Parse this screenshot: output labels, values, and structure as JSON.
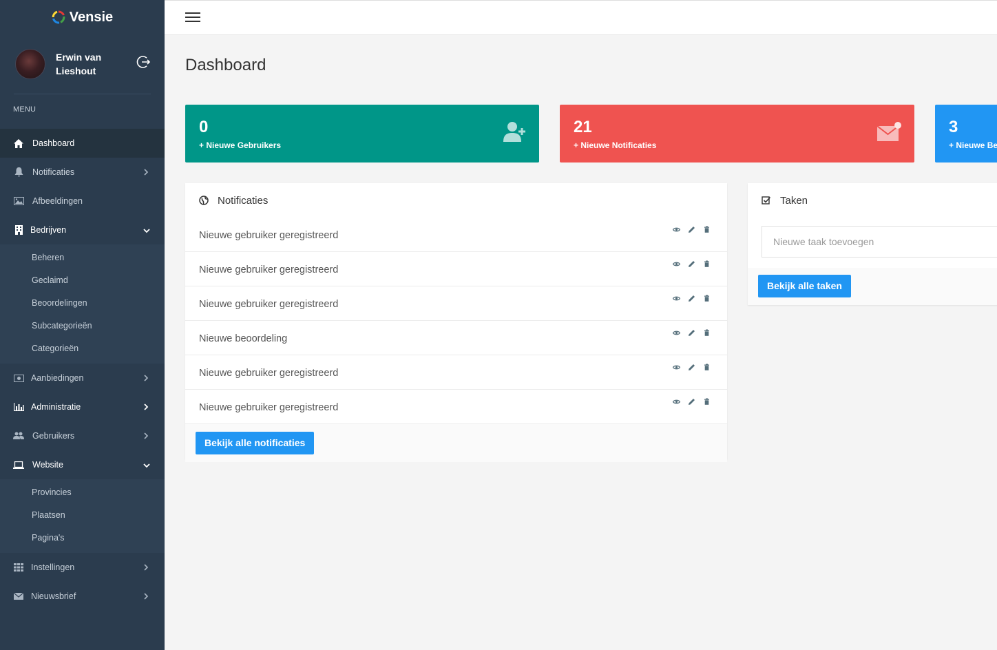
{
  "brand": {
    "name": "Vensie"
  },
  "user": {
    "name": "Erwin van Lieshout"
  },
  "sidebar": {
    "menu_label": "MENU",
    "items": [
      {
        "label": "Dashboard",
        "icon": "home-icon"
      },
      {
        "label": "Notificaties",
        "icon": "bell-icon"
      },
      {
        "label": "Afbeeldingen",
        "icon": "image-icon"
      },
      {
        "label": "Bedrijven",
        "icon": "building-icon",
        "children": [
          "Beheren",
          "Geclaimd",
          "Beoordelingen",
          "Subcategorieën",
          "Categorieën"
        ]
      },
      {
        "label": "Aanbiedingen",
        "icon": "money-icon"
      },
      {
        "label": "Administratie",
        "icon": "bar-chart-icon"
      },
      {
        "label": "Gebruikers",
        "icon": "users-icon"
      },
      {
        "label": "Website",
        "icon": "laptop-icon",
        "children": [
          "Provincies",
          "Plaatsen",
          "Pagina's"
        ]
      },
      {
        "label": "Instellingen",
        "icon": "grid-icon"
      },
      {
        "label": "Nieuwsbrief",
        "icon": "envelope-icon"
      }
    ]
  },
  "page": {
    "title": "Dashboard"
  },
  "stats": [
    {
      "value": "0",
      "label": "+ Nieuwe Gebruikers",
      "color": "#009688"
    },
    {
      "value": "21",
      "label": "+ Nieuwe Notificaties",
      "color": "#ef5350"
    },
    {
      "value": "3",
      "label": "+ Nieuwe Be",
      "color": "#2196f3"
    }
  ],
  "notifications": {
    "title": "Notificaties",
    "items": [
      "Nieuwe gebruiker geregistreerd",
      "Nieuwe gebruiker geregistreerd",
      "Nieuwe gebruiker geregistreerd",
      "Nieuwe beoordeling",
      "Nieuwe gebruiker geregistreerd",
      "Nieuwe gebruiker geregistreerd"
    ],
    "button": "Bekijk alle notificaties"
  },
  "tasks": {
    "title": "Taken",
    "placeholder": "Nieuwe taak toevoegen",
    "button": "Bekijk alle taken"
  }
}
